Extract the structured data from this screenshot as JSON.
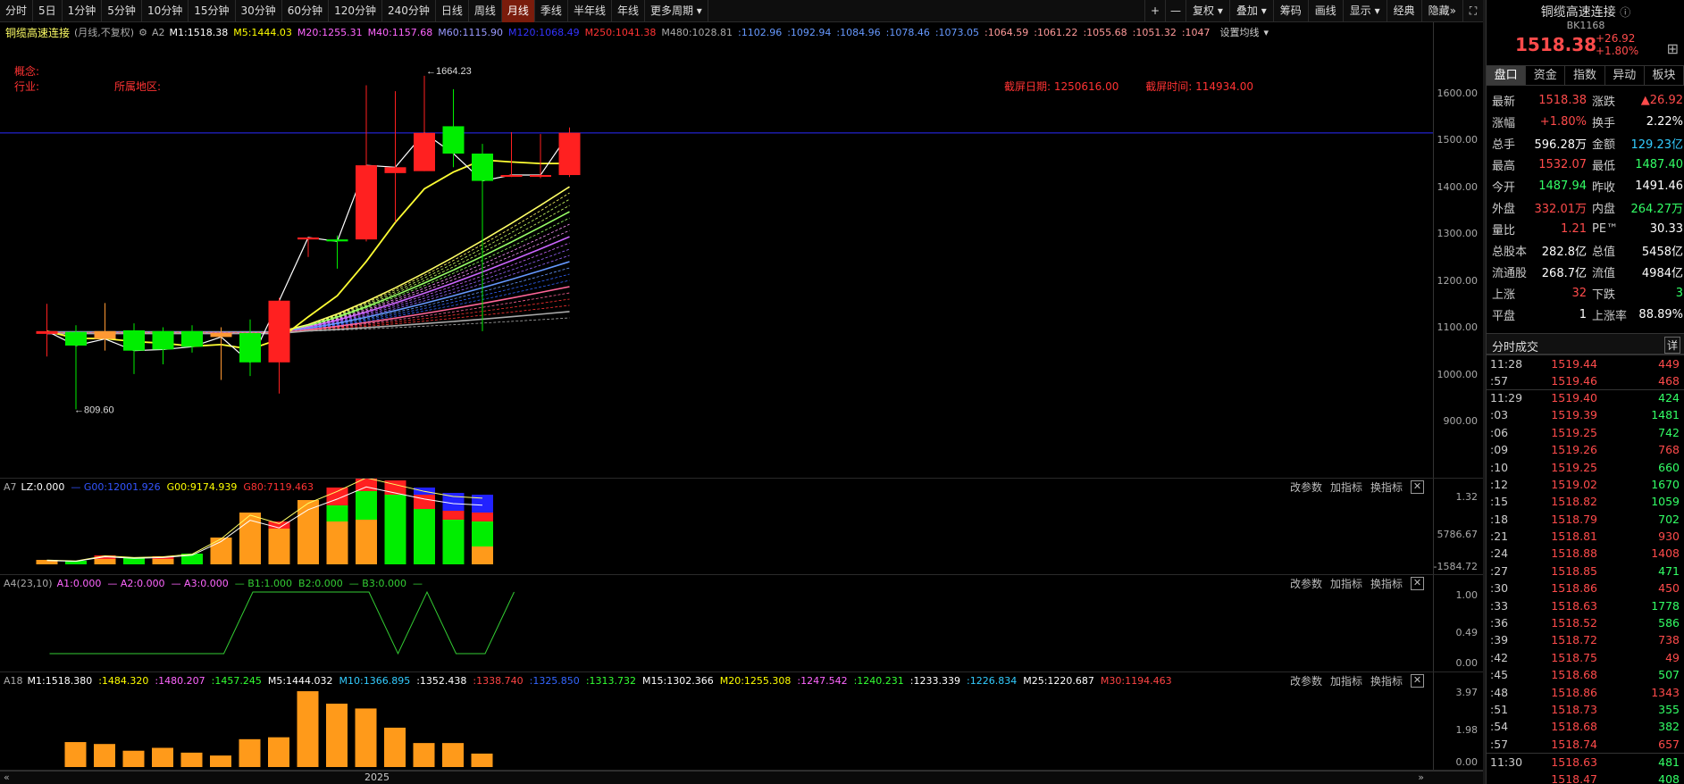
{
  "periods": [
    "分时",
    "5日",
    "1分钟",
    "5分钟",
    "10分钟",
    "15分钟",
    "30分钟",
    "60分钟",
    "120分钟",
    "240分钟",
    "日线",
    "周线",
    "月线",
    "季线",
    "半年线",
    "年线",
    "更多周期"
  ],
  "active_period": "月线",
  "toolbar": {
    "plus": "+",
    "minus": "—",
    "fuquan": "复权",
    "overlay": "叠加",
    "chips": "筹码",
    "draw": "画线",
    "display": "显示",
    "classic": "经典",
    "hide": "隐藏"
  },
  "chart": {
    "name": "铜缆高速连接",
    "mode": "(月线,不复权)",
    "a2": "A2",
    "ma_labels": [
      {
        "text": "M1:1518.38",
        "color": "#ffffff"
      },
      {
        "text": "M5:1444.03",
        "color": "#ffff00"
      },
      {
        "text": "M20:1255.31",
        "color": "#ff66ff"
      },
      {
        "text": "M40:1157.68",
        "color": "#ff66ff"
      },
      {
        "text": "M60:1115.90",
        "color": "#9999ff"
      },
      {
        "text": "M120:1068.49",
        "color": "#3333ff"
      },
      {
        "text": "M250:1041.38",
        "color": "#ff3333"
      },
      {
        "text": "M480:1028.81",
        "color": "#aaaaaa"
      },
      {
        "text": ":1102.96",
        "color": "#6699ff"
      },
      {
        "text": ":1092.94",
        "color": "#6699ff"
      },
      {
        "text": ":1084.96",
        "color": "#6699ff"
      },
      {
        "text": ":1078.46",
        "color": "#6699ff"
      },
      {
        "text": ":1073.05",
        "color": "#6699ff"
      },
      {
        "text": ":1064.59",
        "color": "#ff9999"
      },
      {
        "text": ":1061.22",
        "color": "#ff9999"
      },
      {
        "text": ":1055.68",
        "color": "#ff9999"
      },
      {
        "text": ":1051.32",
        "color": "#ff9999"
      },
      {
        "text": ":1047",
        "color": "#ff9999"
      }
    ],
    "set_ma": "设置均线",
    "concept": "概念:",
    "industry": "行业:",
    "region": "所属地区:",
    "cut_date_label": "截屏日期:",
    "cut_date": "1250616.00",
    "cut_time_label": "截屏时间:",
    "cut_time": "114934.00",
    "high_mark": "1664.23",
    "low_mark": "809.60",
    "y_ticks": [
      "1600.00",
      "1500.00",
      "1400.00",
      "1300.00",
      "1200.00",
      "1100.00",
      "1000.00",
      "900.00"
    ],
    "year_label": "2025"
  },
  "candles": [
    {
      "o": 1003,
      "c": 1010,
      "h": 1080,
      "l": 945
    },
    {
      "o": 1008,
      "c": 973,
      "h": 1025,
      "l": 809.6
    },
    {
      "o": 1010,
      "c": 990,
      "h": 1082,
      "l": 960
    },
    {
      "o": 1012,
      "c": 960,
      "h": 1030,
      "l": 900
    },
    {
      "o": 1010,
      "c": 963,
      "h": 1020,
      "l": 925
    },
    {
      "o": 1010,
      "c": 970,
      "h": 1025,
      "l": 955
    },
    {
      "o": 1005,
      "c": 995,
      "h": 1020,
      "l": 885
    },
    {
      "o": 1005,
      "c": 930,
      "h": 1040,
      "l": 895
    },
    {
      "o": 930,
      "c": 1088,
      "h": 1095,
      "l": 850
    },
    {
      "o": 1245,
      "c": 1250,
      "h": 1250,
      "l": 1200
    },
    {
      "o": 1245,
      "c": 1240,
      "h": 1255,
      "l": 1170
    },
    {
      "o": 1245,
      "c": 1435,
      "h": 1640,
      "l": 1240
    },
    {
      "o": 1415,
      "c": 1430,
      "h": 1625,
      "l": 1290
    },
    {
      "o": 1420,
      "c": 1518,
      "h": 1664.23,
      "l": 1420
    },
    {
      "o": 1535,
      "c": 1465,
      "h": 1630,
      "l": 1430
    },
    {
      "o": 1465,
      "c": 1395,
      "h": 1490,
      "l": 1010
    },
    {
      "o": 1410,
      "c": 1410,
      "h": 1520,
      "l": 1405
    },
    {
      "o": 1408,
      "c": 1410,
      "h": 1515,
      "l": 1402
    },
    {
      "o": 1410,
      "c": 1518.38,
      "h": 1532,
      "l": 1405
    }
  ],
  "panel_a7": {
    "label": "A7",
    "items": [
      {
        "text": "LZ:0.000",
        "color": "#ffffff"
      },
      {
        "text": "— G00:12001.926",
        "color": "#3355ff"
      },
      {
        "text": "G00:9174.939",
        "color": "#ffff00"
      },
      {
        "text": "G80:7119.463",
        "color": "#ff3333"
      }
    ],
    "y_ticks": [
      "1.32",
      "5786.67",
      "-1584.72"
    ],
    "bars": [
      {
        "o": 5,
        "g": 0,
        "r": 0,
        "b": 0
      },
      {
        "o": 0,
        "g": 4,
        "r": 0,
        "b": 0
      },
      {
        "o": 6,
        "g": 0,
        "r": 4,
        "b": 0
      },
      {
        "o": 0,
        "g": 8,
        "r": 0,
        "b": 0
      },
      {
        "o": 6,
        "g": 0,
        "r": 3,
        "b": 0
      },
      {
        "o": 0,
        "g": 12,
        "r": 0,
        "b": 0
      },
      {
        "o": 30,
        "g": 0,
        "r": 0,
        "b": 0
      },
      {
        "o": 58,
        "g": 0,
        "r": 0,
        "b": 0
      },
      {
        "o": 40,
        "g": 0,
        "r": 8,
        "b": 0
      },
      {
        "o": 72,
        "g": 0,
        "r": 0,
        "b": 0
      },
      {
        "o": 48,
        "g": 18,
        "r": 20,
        "b": 0
      },
      {
        "o": 50,
        "g": 32,
        "r": 20,
        "b": 0
      },
      {
        "o": 0,
        "g": 78,
        "r": 16,
        "b": 0
      },
      {
        "o": 0,
        "g": 62,
        "r": 16,
        "b": 8
      },
      {
        "o": 0,
        "g": 50,
        "r": 10,
        "b": 20
      },
      {
        "o": 20,
        "g": 28,
        "r": 10,
        "b": 20
      }
    ]
  },
  "panel_a4": {
    "label": "A4(23,10)",
    "items": [
      {
        "text": "A1:0.000",
        "color": "#ff66ff"
      },
      {
        "text": "— A2:0.000",
        "color": "#ff66ff"
      },
      {
        "text": "— A3:0.000",
        "color": "#ff66ff"
      },
      {
        "text": "— B1:1.000",
        "color": "#33cc33"
      },
      {
        "text": "B2:0.000",
        "color": "#33cc33"
      },
      {
        "text": "— B3:0.000",
        "color": "#33cc33"
      },
      {
        "text": "—",
        "color": "#33cc33"
      }
    ],
    "y_ticks": [
      "1.00",
      "0.49",
      "0.00"
    ],
    "line": [
      0,
      0,
      0,
      0,
      0,
      0,
      0,
      1,
      1,
      1,
      1,
      1,
      0,
      1,
      0,
      0,
      1
    ]
  },
  "panel_a18": {
    "label": "A18",
    "items": [
      {
        "text": "M1:1518.380",
        "color": "#ffffff"
      },
      {
        "text": ":1484.320",
        "color": "#ffff00"
      },
      {
        "text": ":1480.207",
        "color": "#ff66ff"
      },
      {
        "text": ":1457.245",
        "color": "#33ff33"
      },
      {
        "text": "M5:1444.032",
        "color": "#ffffff"
      },
      {
        "text": "M10:1366.895",
        "color": "#33ccff"
      },
      {
        "text": ":1352.438",
        "color": "#ffffff"
      },
      {
        "text": ":1338.740",
        "color": "#ff4444"
      },
      {
        "text": ":1325.850",
        "color": "#3366ff"
      },
      {
        "text": ":1313.732",
        "color": "#33ff33"
      },
      {
        "text": "M15:1302.366",
        "color": "#ffffff"
      },
      {
        "text": "M20:1255.308",
        "color": "#ffff00"
      },
      {
        "text": ":1247.542",
        "color": "#ff66ff"
      },
      {
        "text": ":1240.231",
        "color": "#33ff33"
      },
      {
        "text": ":1233.339",
        "color": "#ffffff"
      },
      {
        "text": ":1226.834",
        "color": "#33ccff"
      },
      {
        "text": "M25:1220.687",
        "color": "#ffffff"
      },
      {
        "text": "M30:1194.463",
        "color": "#ff4444"
      }
    ],
    "y_ticks": [
      "3.97",
      "1.98",
      "0.00"
    ],
    "vol": [
      1.3,
      1.2,
      0.85,
      1.0,
      0.75,
      0.6,
      1.45,
      1.55,
      3.95,
      3.3,
      3.05,
      2.05,
      1.25,
      1.25,
      0.7
    ]
  },
  "panel_ctrl": {
    "params": "改参数",
    "add": "加指标",
    "swap": "换指标"
  },
  "right": {
    "name": "铜缆高速连接",
    "code": "BK1168",
    "price": "1518.38",
    "chg": "+26.92",
    "pct": "+1.80%",
    "tabs": [
      "盘口",
      "资金",
      "指数",
      "异动",
      "板块"
    ],
    "rows": [
      {
        "k": "最新",
        "v": "1518.38",
        "vc": "#ff4b4b",
        "k2": "涨跌",
        "v2": "▲26.92",
        "v2c": "#ff4b4b"
      },
      {
        "k": "涨幅",
        "v": "+1.80%",
        "vc": "#ff4b4b",
        "k2": "换手",
        "v2": "2.22%",
        "v2c": "#ffffff"
      },
      {
        "k": "总手",
        "v": "596.28万",
        "vc": "#ffffff",
        "k2": "金额",
        "v2": "129.23亿",
        "v2c": "#33ccff"
      },
      {
        "k": "最高",
        "v": "1532.07",
        "vc": "#ff4b4b",
        "k2": "最低",
        "v2": "1487.40",
        "v2c": "#33ff66"
      },
      {
        "k": "今开",
        "v": "1487.94",
        "vc": "#33ff66",
        "k2": "昨收",
        "v2": "1491.46",
        "v2c": "#ffffff"
      },
      {
        "k": "外盘",
        "v": "332.01万",
        "vc": "#ff4b4b",
        "k2": "内盘",
        "v2": "264.27万",
        "v2c": "#33ff66"
      },
      {
        "k": "量比",
        "v": "1.21",
        "vc": "#ff4b4b",
        "k2": "PE™",
        "v2": "30.33",
        "v2c": "#ffffff"
      },
      {
        "k": "总股本",
        "v": "282.8亿",
        "vc": "#ffffff",
        "k2": "总值",
        "v2": "5458亿",
        "v2c": "#ffffff"
      },
      {
        "k": "流通股",
        "v": "268.7亿",
        "vc": "#ffffff",
        "k2": "流值",
        "v2": "4984亿",
        "v2c": "#ffffff"
      },
      {
        "k": "上涨",
        "v": "32",
        "vc": "#ff4b4b",
        "k2": "下跌",
        "v2": "3",
        "v2c": "#33ff66"
      },
      {
        "k": "平盘",
        "v": "1",
        "vc": "#ffffff",
        "k2": "上涨率",
        "v2": "88.89%",
        "v2c": "#ffffff"
      }
    ],
    "ticks_title": "分时成交",
    "detail": "详",
    "ticks": [
      {
        "t": "11:28",
        "p": "1519.44",
        "q": "449",
        "qc": "#ff4b4b"
      },
      {
        "t": ":57",
        "p": "1519.46",
        "q": "468",
        "qc": "#ff4b4b"
      },
      {
        "t": "11:29",
        "p": "1519.40",
        "q": "424",
        "qc": "#33ff66"
      },
      {
        "t": ":03",
        "p": "1519.39",
        "q": "1481",
        "qc": "#33ff66"
      },
      {
        "t": ":06",
        "p": "1519.25",
        "q": "742",
        "qc": "#33ff66"
      },
      {
        "t": ":09",
        "p": "1519.26",
        "q": "768",
        "qc": "#ff4b4b"
      },
      {
        "t": ":10",
        "p": "1519.25",
        "q": "660",
        "qc": "#33ff66"
      },
      {
        "t": ":12",
        "p": "1519.02",
        "q": "1670",
        "qc": "#33ff66"
      },
      {
        "t": ":15",
        "p": "1518.82",
        "q": "1059",
        "qc": "#33ff66"
      },
      {
        "t": ":18",
        "p": "1518.79",
        "q": "702",
        "qc": "#33ff66"
      },
      {
        "t": ":21",
        "p": "1518.81",
        "q": "930",
        "qc": "#ff4b4b"
      },
      {
        "t": ":24",
        "p": "1518.88",
        "q": "1408",
        "qc": "#ff4b4b"
      },
      {
        "t": ":27",
        "p": "1518.85",
        "q": "471",
        "qc": "#33ff66"
      },
      {
        "t": ":30",
        "p": "1518.86",
        "q": "450",
        "qc": "#ff4b4b"
      },
      {
        "t": ":33",
        "p": "1518.63",
        "q": "1778",
        "qc": "#33ff66"
      },
      {
        "t": ":36",
        "p": "1518.52",
        "q": "586",
        "qc": "#33ff66"
      },
      {
        "t": ":39",
        "p": "1518.72",
        "q": "738",
        "qc": "#ff4b4b"
      },
      {
        "t": ":42",
        "p": "1518.75",
        "q": "49",
        "qc": "#ff4b4b"
      },
      {
        "t": ":45",
        "p": "1518.68",
        "q": "507",
        "qc": "#33ff66"
      },
      {
        "t": ":48",
        "p": "1518.86",
        "q": "1343",
        "qc": "#ff4b4b"
      },
      {
        "t": ":51",
        "p": "1518.73",
        "q": "355",
        "qc": "#33ff66"
      },
      {
        "t": ":54",
        "p": "1518.68",
        "q": "382",
        "qc": "#33ff66"
      },
      {
        "t": ":57",
        "p": "1518.74",
        "q": "657",
        "qc": "#ff4b4b"
      },
      {
        "t": "11:30",
        "p": "1518.63",
        "q": "481",
        "qc": "#33ff66"
      },
      {
        "t": "",
        "p": "1518.47",
        "q": "408",
        "qc": "#33ff66"
      }
    ]
  }
}
